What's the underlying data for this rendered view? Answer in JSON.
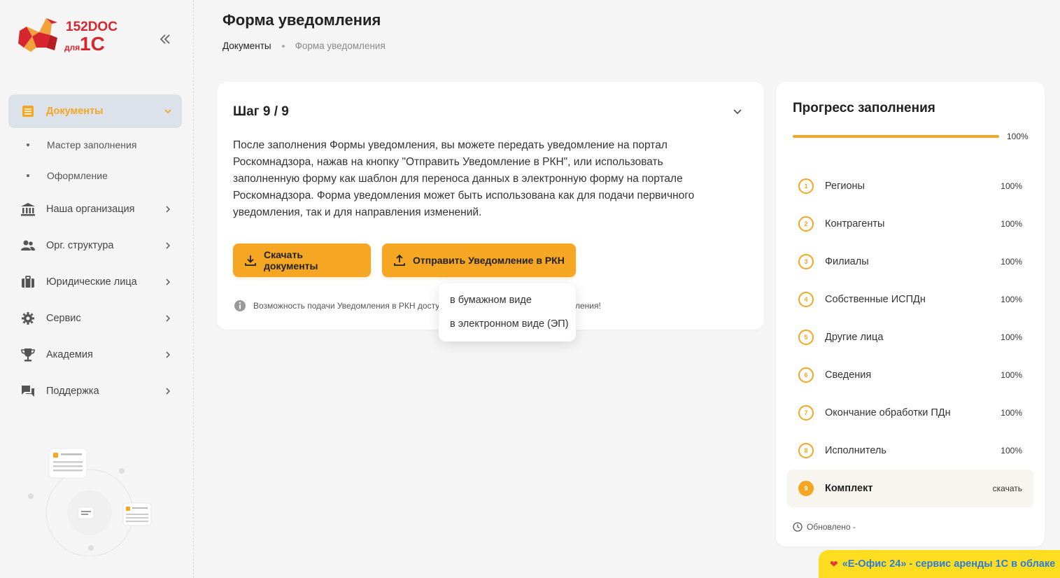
{
  "logo": {
    "text_top": "152DOC",
    "text_prefix": "для",
    "text_brand": "1С"
  },
  "header": {
    "title": "Форма уведомления",
    "breadcrumb": [
      "Документы",
      "Форма уведомления"
    ]
  },
  "sidebar": {
    "items": [
      {
        "label": "Документы",
        "icon": "document-list-icon",
        "active": true
      },
      {
        "label": "Наша организация",
        "icon": "bank-icon"
      },
      {
        "label": "Орг. структура",
        "icon": "users-icon"
      },
      {
        "label": "Юридические лица",
        "icon": "briefcase-icon"
      },
      {
        "label": "Сервис",
        "icon": "gear-icon"
      },
      {
        "label": "Академия",
        "icon": "trophy-icon"
      },
      {
        "label": "Поддержка",
        "icon": "chat-icon"
      }
    ],
    "sub_items": [
      "Мастер заполнения",
      "Оформление"
    ]
  },
  "step": {
    "title": "Шаг 9 / 9",
    "text": "После заполнения Формы уведомления, вы можете передать уведомление на портал Роскомнадзора, нажав на кнопку \"Отправить Уведомление в РКН\", или использовать заполненную форму как шаблон для переноса данных в электронную форму на портале Роскомнадзора. Форма уведомления может быть использована как для подачи первичного уведомления, так и для направления изменений.",
    "download_label": "Скачать документы",
    "send_label": "Отправить Уведомление в РКН",
    "info_text": "Возможность подачи Уведомления в РКН досту",
    "info_text_tail": "ления!"
  },
  "dropdown": {
    "options": [
      "в бумажном виде",
      "в электронном виде (ЭП)"
    ]
  },
  "progress": {
    "title": "Прогресс заполнения",
    "overall": 100,
    "overall_label": "100%",
    "items": [
      {
        "num": "1",
        "label": "Регионы",
        "value": "100%"
      },
      {
        "num": "2",
        "label": "Контрагенты",
        "value": "100%"
      },
      {
        "num": "3",
        "label": "Филиалы",
        "value": "100%"
      },
      {
        "num": "4",
        "label": "Собственные ИСПДн",
        "value": "100%"
      },
      {
        "num": "5",
        "label": "Другие лица",
        "value": "100%"
      },
      {
        "num": "6",
        "label": "Сведения",
        "value": "100%"
      },
      {
        "num": "7",
        "label": "Окончание обработки ПДн",
        "value": "100%"
      },
      {
        "num": "8",
        "label": "Исполнитель",
        "value": "100%"
      },
      {
        "num": "9",
        "label": "Комплект",
        "value": "скачать",
        "current": true
      }
    ],
    "updated_label": "Обновлено -"
  },
  "promo": {
    "text": "«Е-Офис 24» - сервис аренды 1С в облаке"
  },
  "colors": {
    "accent": "#f5a623",
    "active_bg": "#dbe2ea",
    "promo_bg": "#ffde21",
    "promo_text": "#2b7bd8"
  }
}
